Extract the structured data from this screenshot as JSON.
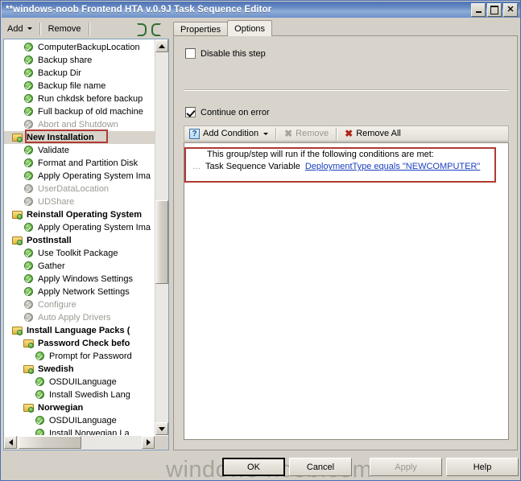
{
  "window": {
    "title": "**windows-noob Frontend HTA v.0.9J Task Sequence Editor",
    "minimize_label": "Minimize",
    "maximize_label": "Maximize",
    "close_label": "Close"
  },
  "toolbar": {
    "add_label": "Add",
    "remove_label": "Remove",
    "move_up_label": "Move Up",
    "move_down_label": "Move Down"
  },
  "tabs": [
    {
      "label": "Properties",
      "active": false
    },
    {
      "label": "Options",
      "active": true
    }
  ],
  "tree": {
    "items": [
      {
        "label": "ComputerBackupLocation",
        "icon": "step-icon",
        "indent": 0,
        "group": false,
        "disabled": false,
        "selected": false
      },
      {
        "label": "Backup share",
        "icon": "step-icon",
        "indent": 0,
        "group": false,
        "disabled": false,
        "selected": false
      },
      {
        "label": "Backup Dir",
        "icon": "step-icon",
        "indent": 0,
        "group": false,
        "disabled": false,
        "selected": false
      },
      {
        "label": "Backup file name",
        "icon": "step-icon",
        "indent": 0,
        "group": false,
        "disabled": false,
        "selected": false
      },
      {
        "label": "Run chkdsk before backup",
        "icon": "step-icon",
        "indent": 0,
        "group": false,
        "disabled": false,
        "selected": false
      },
      {
        "label": "Full backup of old machine",
        "icon": "step-icon",
        "indent": 0,
        "group": false,
        "disabled": false,
        "selected": false
      },
      {
        "label": "Abort and Shutdown",
        "icon": "step-icon",
        "indent": 0,
        "group": false,
        "disabled": true,
        "selected": false
      },
      {
        "label": "New Installation",
        "icon": "folder-icon",
        "indent": 1,
        "group": true,
        "disabled": false,
        "selected": true
      },
      {
        "label": "Validate",
        "icon": "step-icon",
        "indent": 0,
        "group": false,
        "disabled": false,
        "selected": false
      },
      {
        "label": "Format and Partition Disk",
        "icon": "step-icon",
        "indent": 0,
        "group": false,
        "disabled": false,
        "selected": false
      },
      {
        "label": "Apply Operating System Ima",
        "icon": "step-icon",
        "indent": 0,
        "group": false,
        "disabled": false,
        "selected": false
      },
      {
        "label": "UserDataLocation",
        "icon": "step-icon",
        "indent": 0,
        "group": false,
        "disabled": true,
        "selected": false
      },
      {
        "label": "UDShare",
        "icon": "step-icon",
        "indent": 0,
        "group": false,
        "disabled": true,
        "selected": false
      },
      {
        "label": "Reinstall Operating System",
        "icon": "folder-icon",
        "indent": 1,
        "group": true,
        "disabled": false,
        "selected": false
      },
      {
        "label": "Apply Operating System Ima",
        "icon": "step-icon",
        "indent": 0,
        "group": false,
        "disabled": false,
        "selected": false
      },
      {
        "label": "PostInstall",
        "icon": "folder-icon",
        "indent": 1,
        "group": true,
        "disabled": false,
        "selected": false
      },
      {
        "label": "Use Toolkit Package",
        "icon": "step-icon",
        "indent": 0,
        "group": false,
        "disabled": false,
        "selected": false
      },
      {
        "label": "Gather",
        "icon": "step-icon",
        "indent": 0,
        "group": false,
        "disabled": false,
        "selected": false
      },
      {
        "label": "Apply Windows Settings",
        "icon": "step-icon",
        "indent": 0,
        "group": false,
        "disabled": false,
        "selected": false
      },
      {
        "label": "Apply Network Settings",
        "icon": "step-icon",
        "indent": 0,
        "group": false,
        "disabled": false,
        "selected": false
      },
      {
        "label": "Configure",
        "icon": "step-icon",
        "indent": 0,
        "group": false,
        "disabled": true,
        "selected": false
      },
      {
        "label": "Auto Apply Drivers",
        "icon": "step-icon",
        "indent": 0,
        "group": false,
        "disabled": true,
        "selected": false
      },
      {
        "label": "Install Language Packs (",
        "icon": "folder-icon",
        "indent": 1,
        "group": true,
        "disabled": false,
        "selected": false
      },
      {
        "label": "Password Check befo",
        "icon": "folder-icon",
        "indent": 3,
        "group": true,
        "disabled": false,
        "selected": false
      },
      {
        "label": "Prompt for Password",
        "icon": "step-icon",
        "indent": 2,
        "group": false,
        "disabled": false,
        "selected": false
      },
      {
        "label": "Swedish",
        "icon": "folder-icon",
        "indent": 3,
        "group": true,
        "disabled": false,
        "selected": false
      },
      {
        "label": "OSDUILanguage",
        "icon": "step-icon",
        "indent": 2,
        "group": false,
        "disabled": false,
        "selected": false
      },
      {
        "label": "Install Swedish Lang",
        "icon": "step-icon",
        "indent": 2,
        "group": false,
        "disabled": false,
        "selected": false
      },
      {
        "label": "Norwegian",
        "icon": "folder-icon",
        "indent": 3,
        "group": true,
        "disabled": false,
        "selected": false
      },
      {
        "label": "OSDUILanguage",
        "icon": "step-icon",
        "indent": 2,
        "group": false,
        "disabled": false,
        "selected": false
      },
      {
        "label": "Install Norwegian La",
        "icon": "step-icon",
        "indent": 2,
        "group": false,
        "disabled": false,
        "selected": false
      }
    ]
  },
  "options": {
    "disable_step_label": "Disable this step",
    "disable_step_checked": false,
    "continue_on_error_label": "Continue on error",
    "continue_on_error_checked": true,
    "add_condition_label": "Add Condition",
    "remove_label": "Remove",
    "remove_all_label": "Remove All",
    "condition_header": "This group/step will run if the following conditions are met:",
    "condition_prefix": "Task Sequence Variable",
    "condition_expression": "DeploymentType equals \"NEWCOMPUTER\""
  },
  "buttons": {
    "ok": "OK",
    "cancel": "Cancel",
    "apply": "Apply",
    "help": "Help"
  },
  "watermark": "windows-noob.com",
  "colors": {
    "title_bar": "#4e73b3",
    "annotation": "#b03a34",
    "link": "#1a3fbf",
    "face": "#d4d0c8"
  }
}
